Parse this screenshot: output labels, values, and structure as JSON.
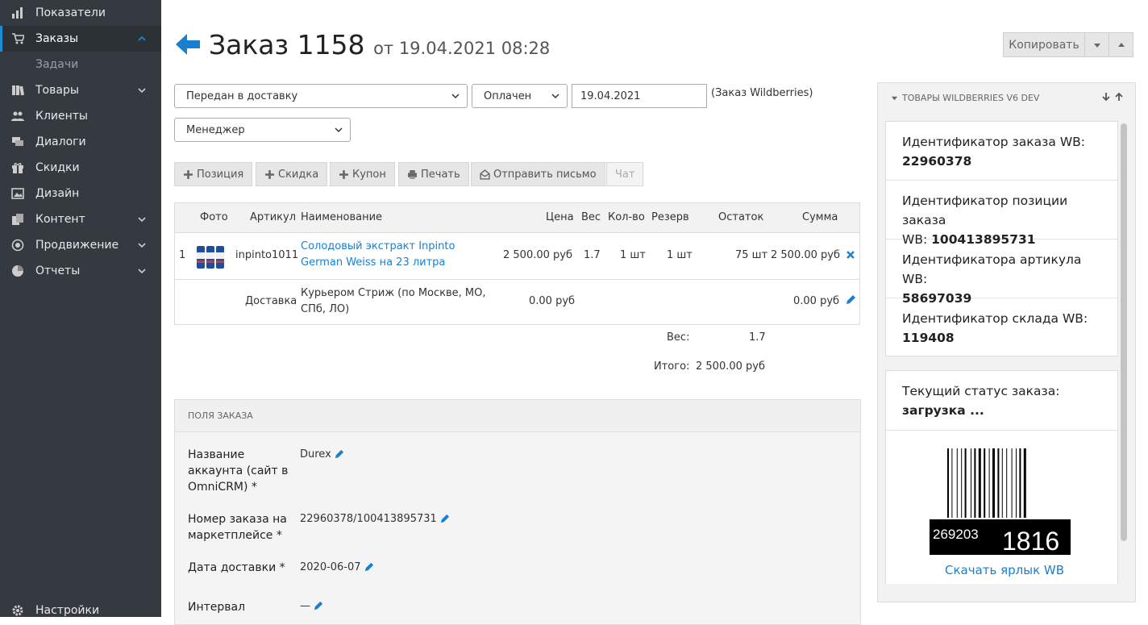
{
  "sidebar": {
    "items": [
      {
        "label": "Показатели"
      },
      {
        "label": "Заказы"
      },
      {
        "label": "Задачи"
      },
      {
        "label": "Товары"
      },
      {
        "label": "Клиенты"
      },
      {
        "label": "Диалоги"
      },
      {
        "label": "Скидки"
      },
      {
        "label": "Дизайн"
      },
      {
        "label": "Контент"
      },
      {
        "label": "Продвижение"
      },
      {
        "label": "Отчеты"
      },
      {
        "label": "Настройки"
      }
    ]
  },
  "header": {
    "title": "Заказ 1158",
    "date": "от 19.04.2021 08:28",
    "copy_label": "Копировать"
  },
  "form": {
    "status": "Передан в доставку",
    "payment": "Оплачен",
    "date": "19.04.2021",
    "source_note": "(Заказ Wildberries)",
    "manager": "Менеджер"
  },
  "toolbar": {
    "position": "Позиция",
    "discount": "Скидка",
    "coupon": "Купон",
    "print": "Печать",
    "send_letter": "Отправить письмо",
    "chat": "Чат"
  },
  "table": {
    "columns": {
      "photo": "Фото",
      "sku": "Артикул",
      "name": "Наименование",
      "price": "Цена",
      "weight": "Вес",
      "qty": "Кол-во",
      "reserve": "Резерв",
      "stock": "Остаток",
      "sum": "Сумма"
    },
    "rows": [
      {
        "num": "1",
        "sku": "inpinto1011",
        "name_line1": "Солодовый экстракт Inpinto",
        "name_line2": "German Weiss на 23 литра",
        "price": "2 500.00 руб",
        "weight": "1.7",
        "qty": "1 шт",
        "reserve": "1 шт",
        "stock": "75 шт",
        "sum": "2 500.00 руб"
      }
    ],
    "delivery": {
      "label": "Доставка",
      "name_line1": "Курьером Стриж (по Москве, МО,",
      "name_line2": "СПб, ЛО)",
      "price": "0.00 руб",
      "sum": "0.00 руб"
    },
    "totals": {
      "weight_label": "Вес:",
      "weight": "1.7",
      "total_label": "Итого:",
      "total": "2 500.00 руб"
    }
  },
  "fields": {
    "header": "ПОЛЯ ЗАКАЗА",
    "items": [
      {
        "label_l1": "Название",
        "label_l2": "аккаунта (сайт в",
        "label_l3": "OmniCRM) *",
        "value": "Durex"
      },
      {
        "label_l1": "Номер заказа на",
        "label_l2": "маркетплейсе *",
        "value": "22960378/100413895731"
      },
      {
        "label_l1": "Дата доставки *",
        "value": "2020-06-07"
      },
      {
        "label_l1": "Интервал",
        "value": "—"
      }
    ]
  },
  "wb_panel": {
    "title": "ТОВАРЫ WILDBERRIES V6 DEV",
    "order_id_label": "Идентификатор заказа WB:",
    "order_id": "22960378",
    "position_id_label_l1": "Идентификатор позиции заказа",
    "position_id_label_l2": "WB:",
    "position_id": "100413895731",
    "article_id_label": "Идентификатора артикула WB:",
    "article_id": "58697039",
    "warehouse_id_label": "Идентификатор склада WB:",
    "warehouse_id": "119408",
    "status_label": "Текущий статус заказа:",
    "status_value": "загрузка ...",
    "barcode_left": "269203",
    "barcode_right": "1816",
    "download_label": "Скачать ярлык WB"
  },
  "colors": {
    "sidebar_bg": "#343a40",
    "accent": "#1a7fd1"
  }
}
